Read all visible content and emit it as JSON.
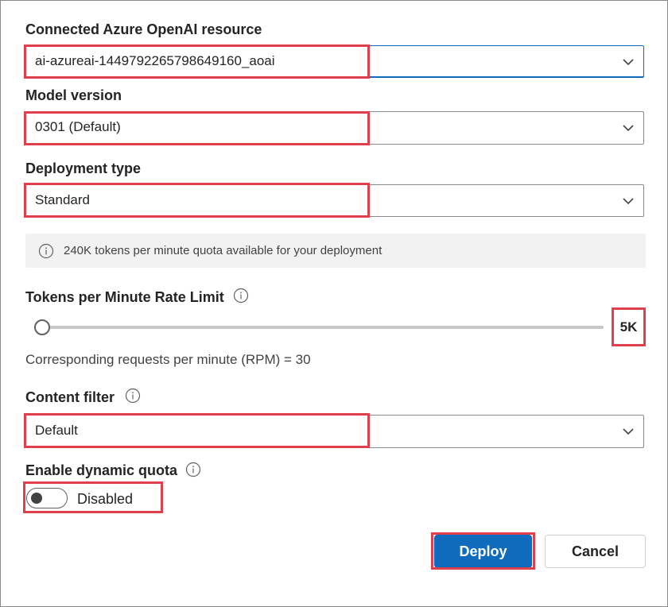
{
  "resource": {
    "label": "Connected Azure OpenAI resource",
    "value": "ai-azureai-1449792265798649160_aoai"
  },
  "model_version": {
    "label": "Model version",
    "value": "0301 (Default)"
  },
  "deployment_type": {
    "label": "Deployment type",
    "value": "Standard"
  },
  "quota_info": {
    "text": "240K tokens per minute quota available for your deployment"
  },
  "rate_limit": {
    "label": "Tokens per Minute Rate Limit",
    "value": "5K",
    "slider_fraction": 0.0,
    "rpm_text": "Corresponding requests per minute (RPM) = 30"
  },
  "content_filter": {
    "label": "Content filter",
    "value": "Default"
  },
  "dynamic_quota": {
    "label": "Enable dynamic quota",
    "state_label": "Disabled",
    "enabled": false
  },
  "actions": {
    "deploy_label": "Deploy",
    "cancel_label": "Cancel"
  },
  "colors": {
    "accent": "#0f6cbd",
    "highlight": "#e0404c"
  }
}
